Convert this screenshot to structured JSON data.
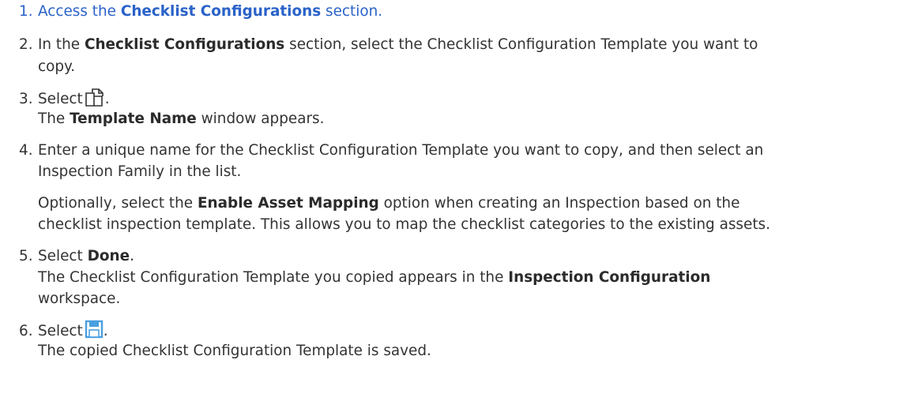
{
  "steps": [
    {
      "num": "1.",
      "lines": [
        {
          "pre": "Access the ",
          "bold": "Checklist Configurations",
          "post": " section."
        }
      ]
    },
    {
      "num": "2.",
      "lines": [
        {
          "pre": "In the ",
          "bold": "Checklist Configurations",
          "post": " section, select the Checklist Configuration Template you want to"
        },
        {
          "pre": "copy."
        }
      ]
    },
    {
      "num": "3.",
      "lines": [
        {
          "pre": "Select",
          "icon": "copy-icon",
          "post": "."
        },
        {
          "pre": "The ",
          "bold": "Template Name",
          "post": " window appears."
        }
      ]
    },
    {
      "num": "4.",
      "lines": [
        {
          "pre": "Enter a unique name for the Checklist Configuration Template you want to copy, and then select an"
        },
        {
          "pre": "Inspection Family in the list."
        }
      ],
      "note": [
        {
          "pre": "Optionally, select the ",
          "bold": "Enable Asset Mapping",
          "post": " option when creating an Inspection based on the"
        },
        {
          "pre": "checklist inspection template. This allows you to map the checklist categories to the existing assets."
        }
      ]
    },
    {
      "num": "5.",
      "lines": [
        {
          "pre": "Select ",
          "bold": "Done",
          "post": "."
        },
        {
          "pre": "The Checklist Configuration Template you copied appears in the ",
          "bold": "Inspection Configuration"
        },
        {
          "pre": "workspace."
        }
      ]
    },
    {
      "num": "6.",
      "lines": [
        {
          "pre": "Select",
          "icon": "save-icon",
          "post": "."
        },
        {
          "pre": "The copied Checklist Configuration Template is saved."
        }
      ]
    }
  ],
  "colors": {
    "link": "#2a62c9",
    "text": "#333333",
    "save_icon": "#4a9fe0"
  }
}
